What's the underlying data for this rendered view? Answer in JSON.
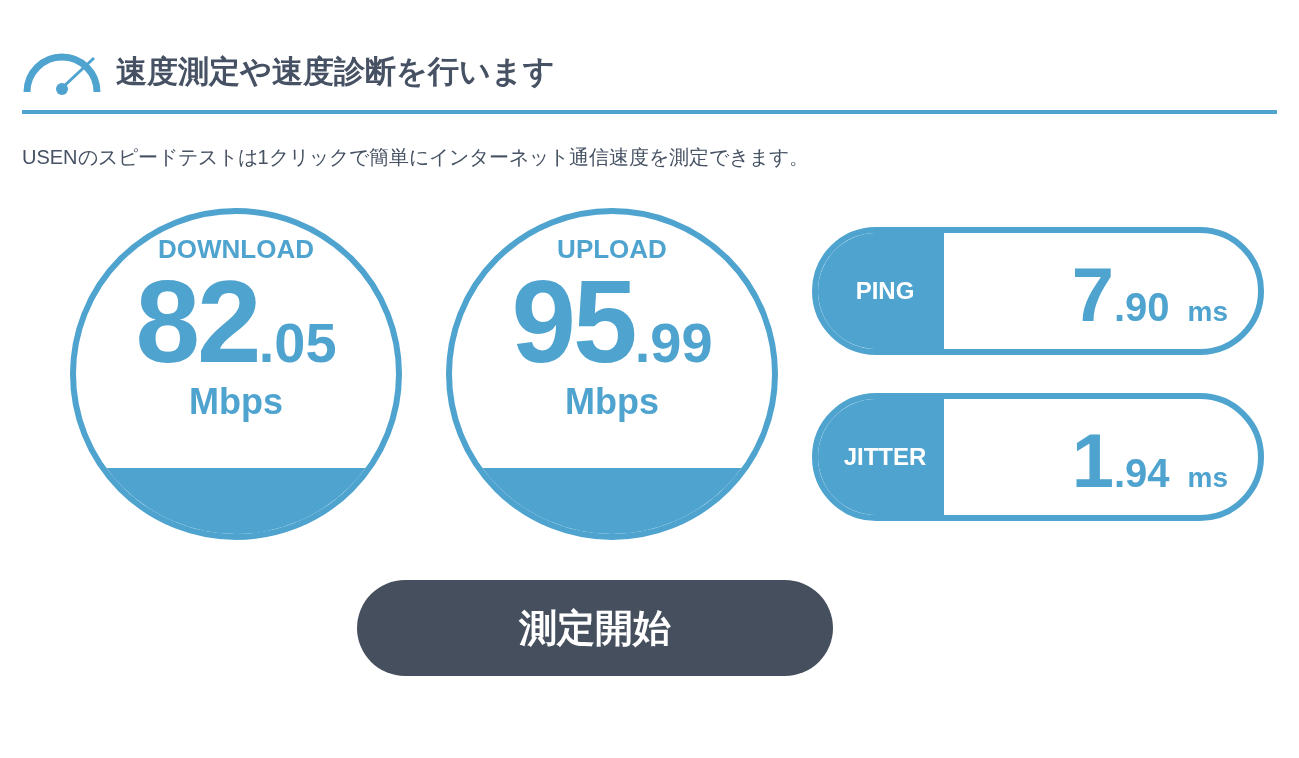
{
  "header": {
    "title": "速度測定や速度診断を行います"
  },
  "description": "USENのスピードテストは1クリックで簡単にインターネット通信速度を測定できます。",
  "gauges": [
    {
      "label": "DOWNLOAD",
      "integer": "82",
      "decimal": ".05",
      "unit": "Mbps"
    },
    {
      "label": "UPLOAD",
      "integer": "95",
      "decimal": ".99",
      "unit": "Mbps"
    }
  ],
  "metrics": [
    {
      "label": "PING",
      "integer": "7",
      "decimal": ".90",
      "unit": "ms"
    },
    {
      "label": "JITTER",
      "integer": "1",
      "decimal": ".94",
      "unit": "ms"
    }
  ],
  "start_button": "測定開始"
}
